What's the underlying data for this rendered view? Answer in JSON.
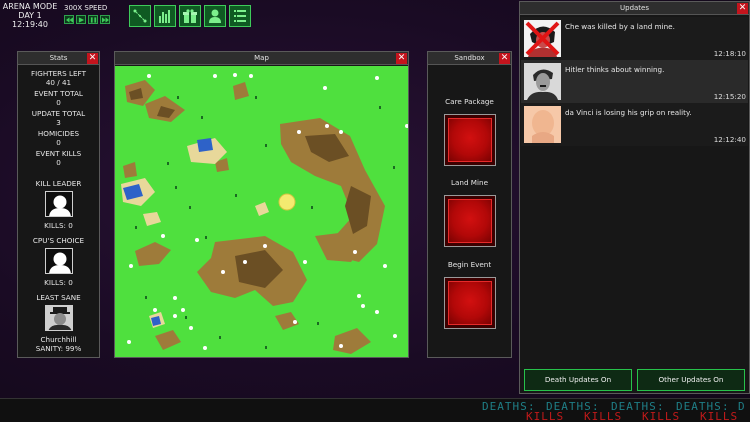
{
  "hud": {
    "mode": "ARENA MODE",
    "day": "DAY 1",
    "clock": "12:19:40",
    "speed_label": "300X SPEED",
    "speed_buttons": [
      "rewind-icon",
      "play-icon",
      "pause-icon",
      "fast-forward-icon"
    ],
    "tools": [
      "map-route-icon",
      "bar-chart-icon",
      "gift-icon",
      "person-icon",
      "list-icon"
    ]
  },
  "stats": {
    "title": "Stats",
    "fighters_left_label": "FIGHTERS LEFT",
    "fighters_left_value": "40 / 41",
    "event_total_label": "EVENT TOTAL",
    "event_total_value": "0",
    "update_total_label": "UPDATE TOTAL",
    "update_total_value": "3",
    "homicides_label": "HOMICIDES",
    "homicides_value": "0",
    "event_kills_label": "EVENT KILLS",
    "event_kills_value": "0",
    "kill_leader_label": "KILL LEADER",
    "kill_leader_kills": "KILLS: 0",
    "cpu_choice_label": "CPU'S CHOICE",
    "cpu_choice_kills": "KILLS: 0",
    "least_sane_label": "LEAST SANE",
    "least_sane_name": "Churchhill",
    "least_sane_sanity": "SANITY: 99%"
  },
  "map": {
    "title": "Map"
  },
  "sandbox": {
    "title": "Sandbox",
    "buttons": [
      "Care Package",
      "Land Mine",
      "Begin Event"
    ]
  },
  "updates": {
    "title": "Updates",
    "items": [
      {
        "message": "Che was killed by a land mine.",
        "time": "12:18:10"
      },
      {
        "message": "Hitler thinks about winning.",
        "time": "12:15:20"
      },
      {
        "message": "da Vinci is losing his grip on reality.",
        "time": "12:12:40"
      }
    ],
    "death_toggle": "Death Updates On",
    "other_toggle": "Other Updates On"
  },
  "ticker": {
    "deaths_word": "DEATHS",
    "kills_word": "KILLS"
  },
  "colors": {
    "grass": "#4fe03e",
    "accent_green": "#3ecb5a",
    "close_red": "#c4141d",
    "ticker_deaths": "#1f7e86",
    "ticker_kills": "#c01a1a"
  }
}
